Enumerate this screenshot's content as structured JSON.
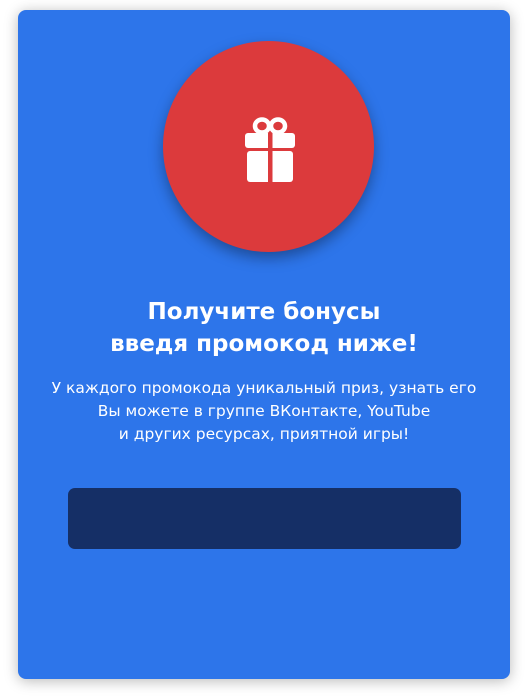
{
  "hero": {
    "icon": "gift-icon",
    "circle_color": "#dc3a3c",
    "card_color": "#2d75ea"
  },
  "title": {
    "line1": "Получите бонусы",
    "line2": "введя промокод ниже!"
  },
  "description": {
    "line1": "У каждого промокода уникальный приз, узнать его",
    "line2": "Вы можете в группе ВКонтакте, YouTube",
    "line3": "и других ресурсах, приятной игры!"
  },
  "promo_input": {
    "value": "",
    "placeholder": "",
    "color": "#152f66"
  }
}
